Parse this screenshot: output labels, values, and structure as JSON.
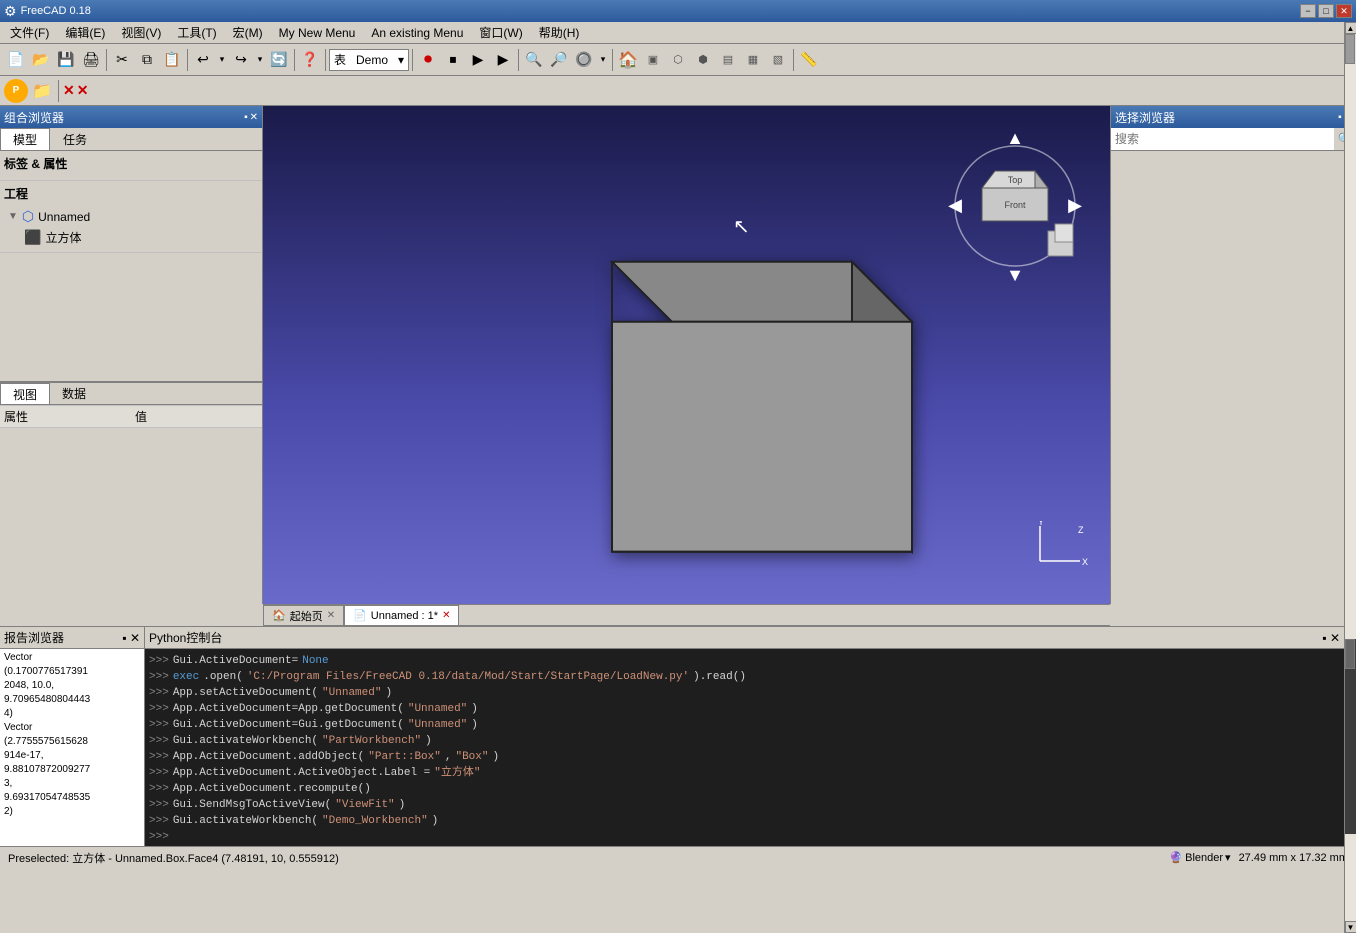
{
  "titlebar": {
    "title": "FreeCAD 0.18",
    "icon": "freecad-icon",
    "min": "−",
    "max": "□",
    "close": "✕"
  },
  "menubar": {
    "items": [
      {
        "label": "文件(F)"
      },
      {
        "label": "编辑(E)"
      },
      {
        "label": "视图(V)"
      },
      {
        "label": "工具(T)"
      },
      {
        "label": "宏(M)"
      },
      {
        "label": "My New Menu"
      },
      {
        "label": "An existing Menu"
      },
      {
        "label": "窗口(W)"
      },
      {
        "label": "帮助(H)"
      }
    ]
  },
  "toolbar": {
    "dropdown_value": "Demo",
    "dropdown_arrow": "▾"
  },
  "left_panel": {
    "title": "组合浏览器",
    "tabs": [
      {
        "label": "模型"
      },
      {
        "label": "任务"
      }
    ],
    "section_label": "标签 & 属性",
    "section_project": "工程",
    "tree_root": "Unnamed",
    "tree_child": "立方体",
    "prop_header1": "属性",
    "prop_header2": "值"
  },
  "right_panel": {
    "title": "选择浏览器",
    "search_placeholder": "搜索"
  },
  "tabbar": {
    "tabs": [
      {
        "label": "起始页",
        "icon": "🏠",
        "closeable": true
      },
      {
        "label": "Unnamed : 1*",
        "icon": "📄",
        "closeable": true,
        "active": true
      }
    ]
  },
  "bottom": {
    "report_title": "报告浏览器",
    "python_title": "Python控制台",
    "report_content": [
      "Vector",
      "(0.1700776517391",
      "2048, 10.0,",
      "9.70965480804443",
      "4)",
      "Vector",
      "(2.7755575615628",
      "914e-17,",
      "9.88107872009277",
      "3,",
      "9.69317054748535",
      "2)"
    ],
    "python_lines": [
      {
        "prompt": ">>>",
        "parts": [
          {
            "type": "normal",
            "text": "Gui.ActiveDocument="
          },
          {
            "type": "none",
            "text": "None"
          }
        ]
      },
      {
        "prompt": ">>>",
        "parts": [
          {
            "type": "keyword",
            "text": "exec"
          },
          {
            "type": "normal",
            "text": ".open("
          },
          {
            "type": "string",
            "text": "'C:/Program Files/FreeCAD 0.18/data/Mod/Start/StartPage/LoadNew.py'"
          },
          {
            "type": "normal",
            "text": ").read()"
          }
        ]
      },
      {
        "prompt": ">>>",
        "parts": [
          {
            "type": "normal",
            "text": "App.setActiveDocument("
          },
          {
            "type": "string",
            "text": "\"Unnamed\""
          },
          {
            "type": "normal",
            "text": ")"
          }
        ]
      },
      {
        "prompt": ">>>",
        "parts": [
          {
            "type": "normal",
            "text": "App.ActiveDocument=App.getDocument("
          },
          {
            "type": "string",
            "text": "\"Unnamed\""
          },
          {
            "type": "normal",
            "text": ")"
          }
        ]
      },
      {
        "prompt": ">>>",
        "parts": [
          {
            "type": "normal",
            "text": "Gui.ActiveDocument=Gui.getDocument("
          },
          {
            "type": "string",
            "text": "\"Unnamed\""
          },
          {
            "type": "normal",
            "text": ")"
          }
        ]
      },
      {
        "prompt": ">>>",
        "parts": [
          {
            "type": "normal",
            "text": "Gui.activateWorkbench("
          },
          {
            "type": "string",
            "text": "\"PartWorkbench\""
          },
          {
            "type": "normal",
            "text": ")"
          }
        ]
      },
      {
        "prompt": ">>>",
        "parts": [
          {
            "type": "normal",
            "text": "App.ActiveDocument.addObject("
          },
          {
            "type": "string",
            "text": "\"Part::Box\""
          },
          {
            "type": "normal",
            "text": ", "
          },
          {
            "type": "string",
            "text": "\"Box\""
          },
          {
            "type": "normal",
            "text": ")"
          }
        ]
      },
      {
        "prompt": ">>>",
        "parts": [
          {
            "type": "normal",
            "text": "App.ActiveDocument.ActiveObject.Label = "
          },
          {
            "type": "string",
            "text": "\"立方体\""
          }
        ]
      },
      {
        "prompt": ">>>",
        "parts": [
          {
            "type": "normal",
            "text": "App.ActiveDocument.recompute()"
          }
        ]
      },
      {
        "prompt": ">>>",
        "parts": [
          {
            "type": "normal",
            "text": "Gui.SendMsgToActiveView("
          },
          {
            "type": "string",
            "text": "\"ViewFit\""
          },
          {
            "type": "normal",
            "text": ")"
          }
        ]
      },
      {
        "prompt": ">>>",
        "parts": [
          {
            "type": "normal",
            "text": "Gui.activateWorkbench("
          },
          {
            "type": "string",
            "text": "\"Demo_Workbench\""
          },
          {
            "type": "normal",
            "text": ")"
          }
        ]
      },
      {
        "prompt": ">>>",
        "parts": []
      }
    ]
  },
  "statusbar": {
    "left": "Preselected: 立方体 - Unnamed.Box.Face4 (7.48191, 10, 0.555912)",
    "renderer": "Blender",
    "dimensions": "27.49 mm x 17.32 mm"
  },
  "view_tabs": [
    {
      "label": "视图",
      "active": true
    },
    {
      "label": "数据",
      "active": false
    }
  ]
}
